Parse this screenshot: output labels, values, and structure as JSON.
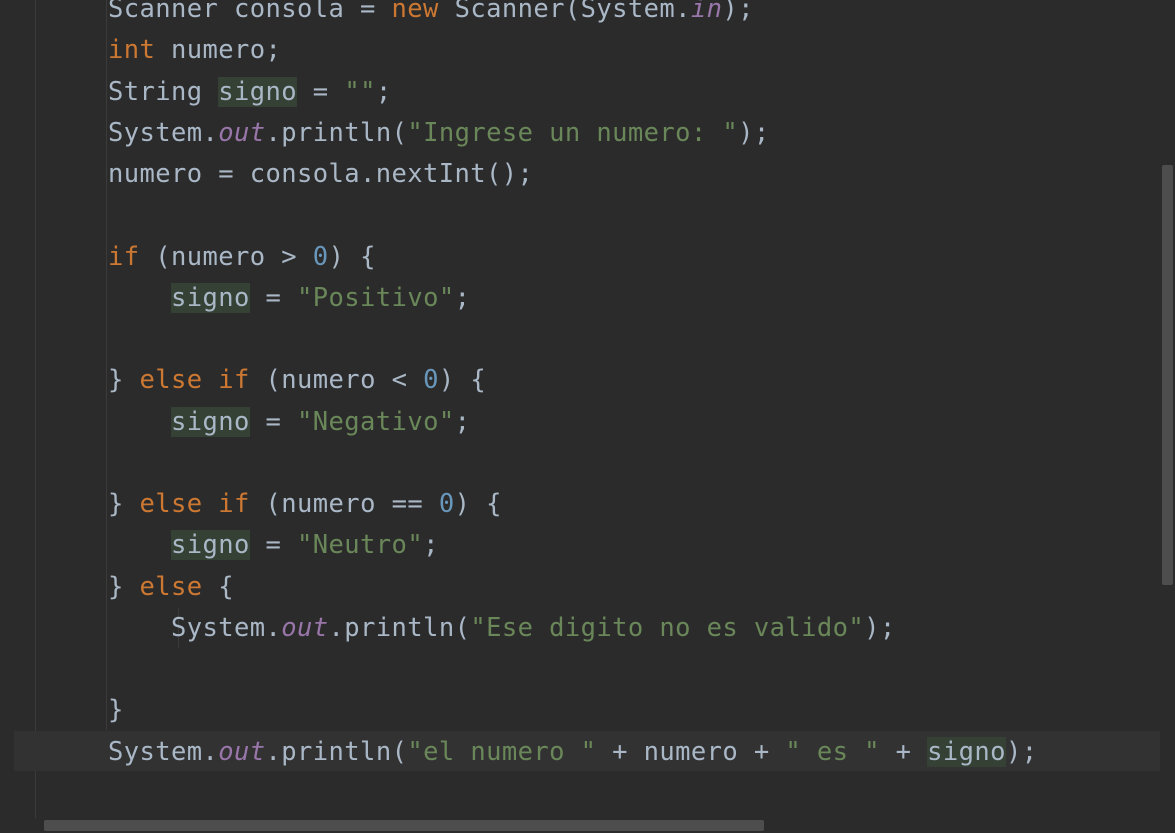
{
  "editor": {
    "lines": [
      [
        [
          "Scanner consola = ",
          "t"
        ],
        [
          "new",
          "kw"
        ],
        [
          " Scanner(System.",
          "t"
        ],
        [
          "in",
          "fld"
        ],
        [
          ");",
          "t"
        ]
      ],
      [
        [
          "int",
          "kw"
        ],
        [
          " numero;",
          "t"
        ]
      ],
      [
        [
          "String ",
          "t"
        ],
        [
          "signo",
          "hl"
        ],
        [
          " = ",
          "t"
        ],
        [
          "\"\"",
          "str"
        ],
        [
          ";",
          "t"
        ]
      ],
      [
        [
          "System.",
          "t"
        ],
        [
          "out",
          "fld"
        ],
        [
          ".println(",
          "t"
        ],
        [
          "\"Ingrese un numero: \"",
          "str"
        ],
        [
          ");",
          "t"
        ]
      ],
      [
        [
          "numero = consola.nextInt();",
          "t"
        ]
      ],
      [],
      [
        [
          "if",
          "kw"
        ],
        [
          " (numero > ",
          "t"
        ],
        [
          "0",
          "num"
        ],
        [
          ") {",
          "t"
        ]
      ],
      [
        [
          "    ",
          "t"
        ],
        [
          "signo",
          "hl"
        ],
        [
          " = ",
          "t"
        ],
        [
          "\"Positivo\"",
          "str"
        ],
        [
          ";",
          "t"
        ]
      ],
      [],
      [
        [
          "} ",
          "t"
        ],
        [
          "else if",
          "kw"
        ],
        [
          " (numero < ",
          "t"
        ],
        [
          "0",
          "num"
        ],
        [
          ") {",
          "t"
        ]
      ],
      [
        [
          "    ",
          "t"
        ],
        [
          "signo",
          "hl"
        ],
        [
          " = ",
          "t"
        ],
        [
          "\"Negativo\"",
          "str"
        ],
        [
          ";",
          "t"
        ]
      ],
      [],
      [
        [
          "} ",
          "t"
        ],
        [
          "else if",
          "kw"
        ],
        [
          " (numero == ",
          "t"
        ],
        [
          "0",
          "num"
        ],
        [
          ") {",
          "t"
        ]
      ],
      [
        [
          "    ",
          "t"
        ],
        [
          "signo",
          "hl"
        ],
        [
          " = ",
          "t"
        ],
        [
          "\"Neutro\"",
          "str"
        ],
        [
          ";",
          "t"
        ]
      ],
      [
        [
          "} ",
          "t"
        ],
        [
          "else",
          "kw"
        ],
        [
          " {",
          "t"
        ]
      ],
      [
        [
          "    System.",
          "t"
        ],
        [
          "out",
          "fld"
        ],
        [
          ".println(",
          "t"
        ],
        [
          "\"Ese digito no es valido\"",
          "str"
        ],
        [
          ");",
          "t"
        ]
      ],
      [],
      [
        [
          "}",
          "t"
        ]
      ],
      [
        [
          "System.",
          "t"
        ],
        [
          "out",
          "fld"
        ],
        [
          ".println(",
          "t"
        ],
        [
          "\"el numero \"",
          "str"
        ],
        [
          " + numero + ",
          "t"
        ],
        [
          "\" es \"",
          "str"
        ],
        [
          " + ",
          "t"
        ],
        [
          "signo",
          "hl"
        ],
        [
          ");",
          "t"
        ]
      ]
    ]
  },
  "colors": {
    "background": "#2b2b2b",
    "default_text": "#a9b7c6",
    "keyword": "#cc7832",
    "string": "#6a8759",
    "number": "#6897bb",
    "static_field": "#9876aa",
    "identifier_highlight": "#344134"
  }
}
